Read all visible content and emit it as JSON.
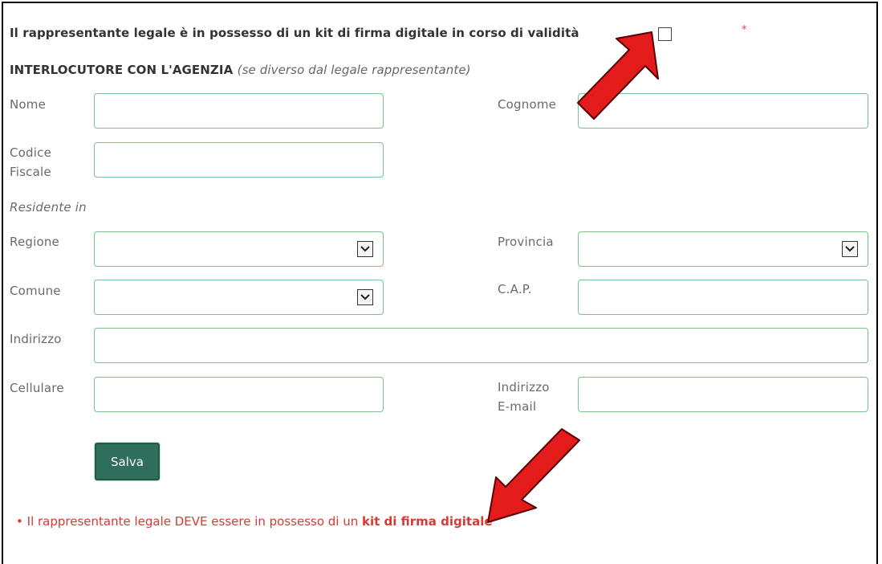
{
  "kit_question": {
    "label": "Il rappresentante legale è in possesso di un kit di firma digitale in corso di validità",
    "required_mark": "*"
  },
  "section": {
    "title": "INTERLOCUTORE CON L'AGENZIA",
    "note": "(se diverso dal legale rappresentante)"
  },
  "fields": {
    "nome": "Nome",
    "cognome": "Cognome",
    "codice_fiscale_1": "Codice",
    "codice_fiscale_2": "Fiscale",
    "residente_in": "Residente in",
    "regione": "Regione",
    "provincia": "Provincia",
    "comune": "Comune",
    "cap": "C.A.P.",
    "indirizzo": "Indirizzo",
    "cellulare": "Cellulare",
    "email_1": "Indirizzo",
    "email_2": "E-mail"
  },
  "buttons": {
    "save": "Salva"
  },
  "notice": {
    "bullet": "•",
    "text": "Il rappresentante legale DEVE essere in possesso di un",
    "bold": "kit di firma digitale"
  },
  "colors": {
    "field_border": "#7cc28e",
    "button": "#2f6e5b",
    "arrow": "#e41b1b",
    "notice": "#d63a32"
  }
}
